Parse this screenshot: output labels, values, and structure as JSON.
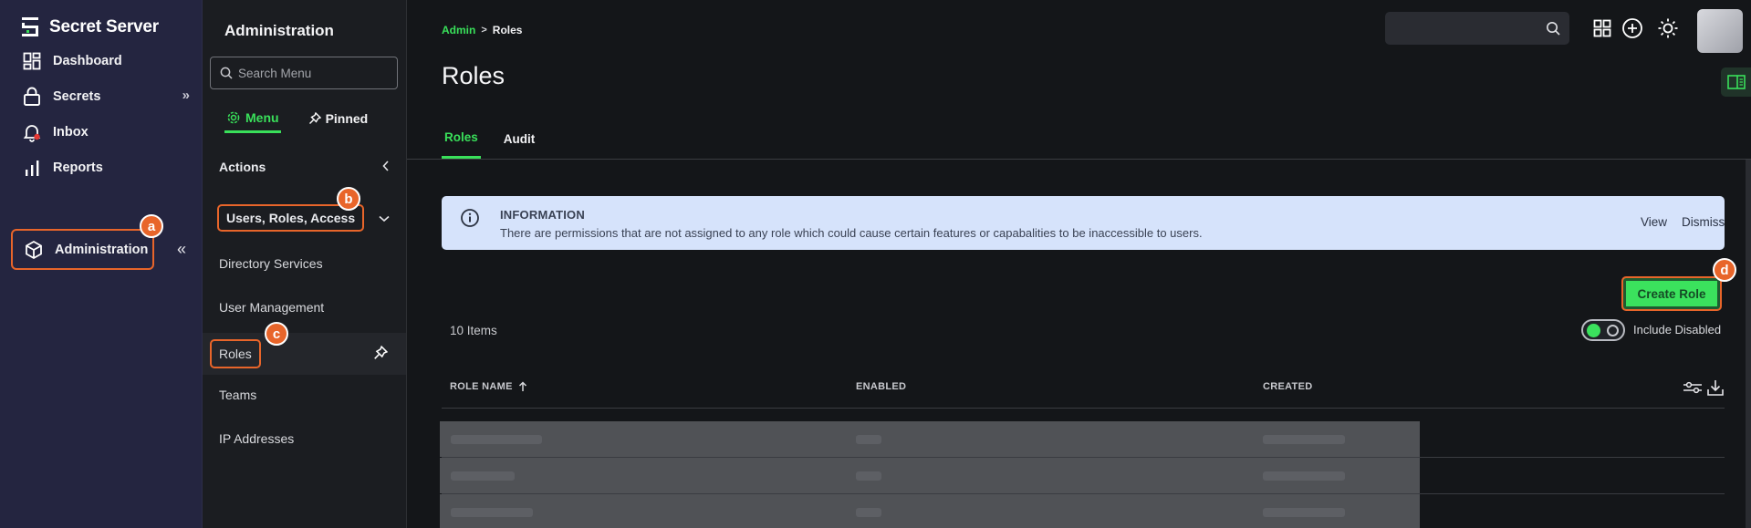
{
  "app": {
    "brand": "Secret Server",
    "accent": "#39e05a",
    "callout_color": "#e8652a"
  },
  "nav": {
    "items": [
      {
        "label": "Dashboard",
        "icon": "dashboard-icon"
      },
      {
        "label": "Secrets",
        "icon": "lock-icon"
      },
      {
        "label": "Inbox",
        "icon": "bell-icon"
      },
      {
        "label": "Reports",
        "icon": "bar-chart-icon"
      },
      {
        "label": "Administration",
        "icon": "cube-icon"
      }
    ],
    "secrets_expand": "»",
    "collapse": "«"
  },
  "callouts": {
    "a": "a",
    "b": "b",
    "c": "c",
    "d": "d"
  },
  "submenu": {
    "title": "Administration",
    "search_placeholder": "Search Menu",
    "tabs": [
      {
        "label": "Menu",
        "icon": "gear-icon"
      },
      {
        "label": "Pinned",
        "icon": "pin-icon"
      }
    ],
    "sections": {
      "actions": "Actions",
      "users_roles_access": "Users, Roles, Access"
    },
    "items": [
      "Directory Services",
      "User Management",
      "Roles",
      "Teams",
      "IP Addresses"
    ]
  },
  "main": {
    "breadcrumb": {
      "parent": "Admin",
      "separator": ">",
      "current": "Roles"
    },
    "title": "Roles",
    "tabs": [
      "Roles",
      "Audit"
    ],
    "info": {
      "title": "INFORMATION",
      "text": "There are permissions that are not assigned to any role which could cause certain features or capabalities to be inaccessible to users.",
      "view": "View",
      "dismiss": "Dismiss"
    },
    "create_button": "Create Role",
    "items_count": "10 Items",
    "include_disabled": "Include Disabled",
    "columns": {
      "role_name": "ROLE NAME",
      "enabled": "ENABLED",
      "created": "CREATED"
    }
  }
}
